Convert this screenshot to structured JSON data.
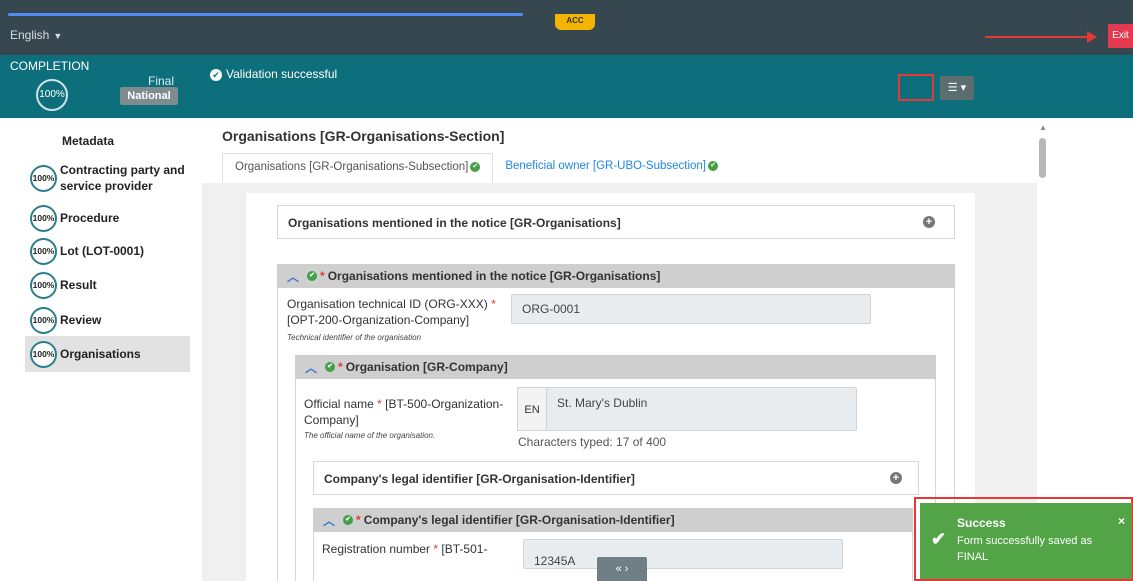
{
  "topbar": {
    "language": "English",
    "env_badge": "ACC",
    "exit_label": "Exit"
  },
  "completion": {
    "label": "COMPLETION",
    "percent": "100%",
    "stage": "Final",
    "scope": "National",
    "validation_message": "Validation successful"
  },
  "sidebar": {
    "items": [
      {
        "label": "Metadata",
        "percent": ""
      },
      {
        "label": "Contracting party and service provider",
        "percent": "100%"
      },
      {
        "label": "Procedure",
        "percent": "100%"
      },
      {
        "label": "Lot (LOT-0001)",
        "percent": "100%"
      },
      {
        "label": "Result",
        "percent": "100%"
      },
      {
        "label": "Review",
        "percent": "100%"
      },
      {
        "label": "Organisations",
        "percent": "100%"
      }
    ]
  },
  "main": {
    "title": "Organisations [GR-Organisations-Section]",
    "tabs": [
      {
        "label": "Organisations  [GR-Organisations-Subsection]"
      },
      {
        "label": "Beneficial owner  [GR-UBO-Subsection]"
      }
    ],
    "collapsed_group_title": "Organisations mentioned in the notice  [GR-Organisations]",
    "expanded_group_title": "Organisations mentioned in the notice  [GR-Organisations]",
    "tech_id": {
      "label": "Organisation technical ID (ORG-XXX)",
      "label2": "[OPT-200-Organization-Company]",
      "hint": "Technical identifier of the organisation",
      "value": "ORG-0001"
    },
    "org_group_title": "Organisation  [GR-Company]",
    "official_name": {
      "label": "Official name",
      "label_ref1": "[BT-500-Organization-",
      "label_ref2": "Company]",
      "hint": "The official name of the organisation.",
      "lang": "EN",
      "value": "St. Mary's Dublin",
      "chars": "Characters typed: 17 of 400"
    },
    "legal_id_collapsed_title": "Company's legal identifier  [GR-Organisation-Identifier]",
    "legal_id_expanded_title": "Company's legal identifier  [GR-Organisation-Identifier]",
    "registration": {
      "label": "Registration number",
      "label_ref": "[BT-501-",
      "value": "12345A"
    }
  },
  "toast": {
    "title": "Success",
    "message": "Form successfully saved as FINAL"
  },
  "icons": {
    "check": "✔",
    "close": "×",
    "chevron_up": "^",
    "plus": "+",
    "pager": "«  ›"
  },
  "colors": {
    "topbar": "#37474f",
    "band": "#0e6f7c",
    "success": "#52a447",
    "exit": "#e53950",
    "highlight": "#e53935"
  }
}
